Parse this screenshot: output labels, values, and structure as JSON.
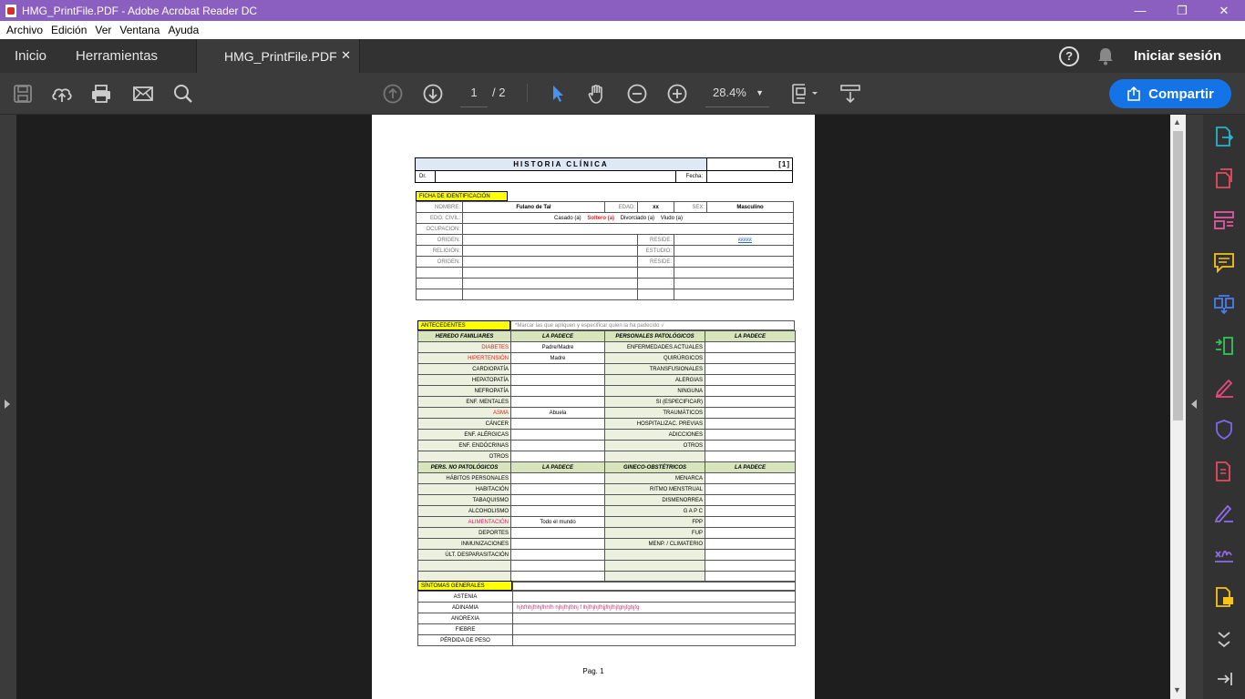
{
  "window": {
    "title": "HMG_PrintFile.PDF - Adobe Acrobat Reader DC"
  },
  "menu": [
    "Archivo",
    "Edición",
    "Ver",
    "Ventana",
    "Ayuda"
  ],
  "tabs": {
    "home": "Inicio",
    "tools": "Herramientas",
    "document": "HMG_PrintFile.PDF",
    "signin": "Iniciar sesión"
  },
  "toolbar": {
    "page_current": "1",
    "page_total": "/ 2",
    "zoom": "28.4%",
    "share": "Compartir"
  },
  "doc": {
    "title": "HISTORIA CLÍNICA",
    "number": "[1]",
    "dr_label": "Dr.",
    "fecha_label": "Fecha:",
    "ficha": "FICHA DE IDENTIFICACIÓN",
    "nombre_label": "NOMBRE:",
    "nombre": "Fulano de Tal",
    "edad_label": "EDAD:",
    "edad": "xx",
    "sexo_label": "SEX:",
    "sexo": "Masculino",
    "civil_label": "EDO. CIVIL:",
    "civil_opts": [
      "Casado (a)",
      "Soltero (a)",
      "Divorciado (a)",
      "Viudo (a)"
    ],
    "ocupacion_label": "OCUPACION:",
    "origen_label": "ORIGEN:",
    "reside_label": "RESIDE:",
    "reside_val": "kkkkk",
    "religion_label": "RELIGIÓN:",
    "estudio_label": "ESTUDIO:",
    "antecedentes": "ANTECEDENTES",
    "ante_note": "*Marcar las que apliquen y especificar quien la ha padecido   √",
    "hdr_hf": "HEREDO FAMILIARES",
    "hdr_lp": "LA PADECE",
    "hdr_pp": "PERSONALES PATOLÓGICOS",
    "hf": [
      {
        "a": "DIABETES",
        "b": "Padre/Madre",
        "c": "ENFERMEDADES ACTUALES",
        "red": true
      },
      {
        "a": "HIPERTENSIÓN",
        "b": "Madre",
        "c": "QUIRÚRGICOS",
        "red": true
      },
      {
        "a": "CARDIOPATÍA",
        "b": "",
        "c": "TRANSFUSIONALES"
      },
      {
        "a": "HEPATOPATÍA",
        "b": "",
        "c": "ALERGIAS"
      },
      {
        "a": "NEFROPATÍA",
        "b": "",
        "c": "NINGUNA"
      },
      {
        "a": "ENF. MENTALES",
        "b": "",
        "c": "SI (ESPECIFICAR)"
      },
      {
        "a": "ASMA",
        "b": "Abuela",
        "c": "TRAUMÁTICOS",
        "red": true
      },
      {
        "a": "CÁNCER",
        "b": "",
        "c": "HOSPITALIZAC. PREVIAS"
      },
      {
        "a": "ENF. ALÉRGICAS",
        "b": "",
        "c": "ADICCIONES"
      },
      {
        "a": "ENF. ENDÓCRINAS",
        "b": "",
        "c": "OTROS"
      },
      {
        "a": "OTROS",
        "b": "",
        "c": ""
      }
    ],
    "hdr_np": "PERS. NO PATOLÓGICOS",
    "hdr_go": "GINECO-OBSTÉTRICOS",
    "np": [
      {
        "a": "HÁBITOS PERSONALES",
        "b": "",
        "c": "MENARCA"
      },
      {
        "a": "HABITACIÓN",
        "b": "",
        "c": "RITMO MENSTRUAL"
      },
      {
        "a": "TABAQUISMO",
        "b": "",
        "c": "DISMENORREA"
      },
      {
        "a": "ALCOHOLISMO",
        "b": "",
        "c": "G A P C"
      },
      {
        "a": "ALIMENTACIÓN",
        "b": "Todo el mundo",
        "c": "FPP",
        "mag": true
      },
      {
        "a": "DEPORTES",
        "b": "",
        "c": "FUP"
      },
      {
        "a": "INMUNIZACIONES",
        "b": "",
        "c": "MENP. / CLIMATERIO"
      },
      {
        "a": "ÚLT. DESPARASITACIÓN",
        "b": "",
        "c": ""
      },
      {
        "a": "",
        "b": "",
        "c": ""
      },
      {
        "a": "",
        "b": "",
        "c": ""
      }
    ],
    "sintomas": "SÍNTOMAS GENERALES",
    "sg": [
      {
        "a": "ASTENIA",
        "b": ""
      },
      {
        "a": "ADINAMIA",
        "b": "hjhfhhjfhhjfhhfh  hjhjfhjfhhj    f    lhjfhjhjfhjjfhjfhjfghjfghjfg"
      },
      {
        "a": "ANOREXIA",
        "b": ""
      },
      {
        "a": "FIEBRE",
        "b": ""
      },
      {
        "a": "PÉRDIDA DE PESO",
        "b": ""
      }
    ],
    "pagenum": "Pag. 1"
  }
}
